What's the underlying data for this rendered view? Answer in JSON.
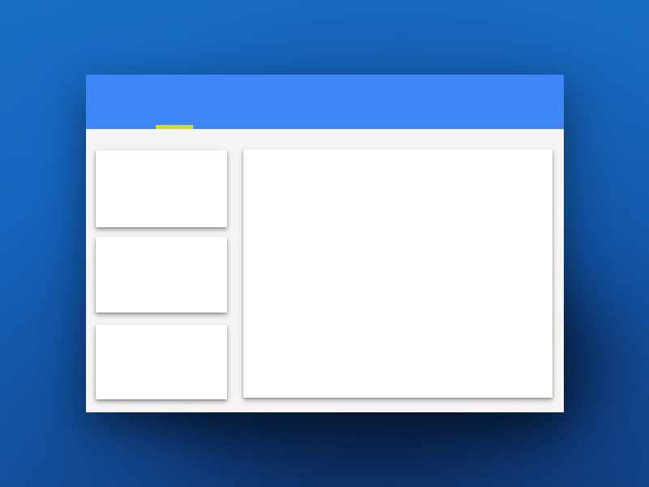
{
  "theme": {
    "header_color": "#3d87f7",
    "tab_indicator_color": "#cddc39",
    "content_background": "#f5f5f5",
    "card_color": "#ffffff",
    "desktop_color": "#1565c0"
  },
  "header": {
    "active_tab_index": 0
  },
  "sidebar": {
    "cards": [
      {
        "id": "card-1"
      },
      {
        "id": "card-2"
      },
      {
        "id": "card-3"
      }
    ]
  },
  "main": {
    "panel": {
      "id": "main-panel"
    }
  }
}
